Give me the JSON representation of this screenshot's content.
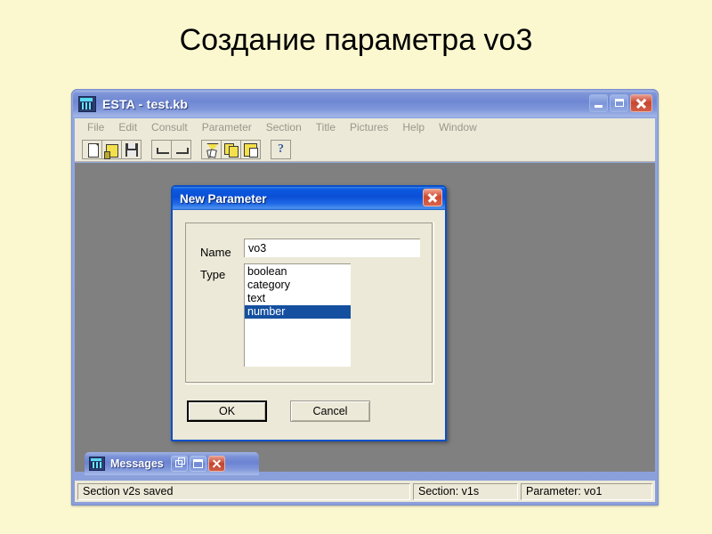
{
  "slide": {
    "title": "Создание параметра vo3",
    "background_color": "#fbf8d0"
  },
  "app_window": {
    "title": "ESTA - test.kb",
    "icon": "esta-app-icon",
    "title_bar_color": "#7f96da",
    "client_color": "#808080",
    "controls": {
      "minimize": "Minimize",
      "maximize": "Maximize",
      "close": "Close"
    },
    "menu": [
      {
        "label": "File"
      },
      {
        "label": "Edit"
      },
      {
        "label": "Consult"
      },
      {
        "label": "Parameter"
      },
      {
        "label": "Section"
      },
      {
        "label": "Title"
      },
      {
        "label": "Pictures"
      },
      {
        "label": "Help"
      },
      {
        "label": "Window"
      }
    ],
    "toolbar": [
      {
        "icon": "new-document-icon",
        "tooltip": "New"
      },
      {
        "icon": "open-folder-icon",
        "tooltip": "Open"
      },
      {
        "icon": "save-floppy-icon",
        "tooltip": "Save"
      },
      {
        "icon": "undo-icon",
        "tooltip": "Undo"
      },
      {
        "icon": "redo-icon",
        "tooltip": "Redo"
      },
      {
        "icon": "cut-scissors-icon",
        "tooltip": "Cut"
      },
      {
        "icon": "copy-icon",
        "tooltip": "Copy"
      },
      {
        "icon": "paste-icon",
        "tooltip": "Paste"
      },
      {
        "icon": "help-question-icon",
        "tooltip": "Help"
      }
    ]
  },
  "dialog": {
    "title": "New Parameter",
    "title_bar_color": "#0a4fd6",
    "close_label": "Close",
    "name": {
      "label": "Name",
      "value": "vo3",
      "placeholder": ""
    },
    "type": {
      "label": "Type",
      "options": [
        {
          "label": "boolean",
          "selected": false
        },
        {
          "label": "category",
          "selected": false
        },
        {
          "label": "text",
          "selected": false
        },
        {
          "label": "number",
          "selected": true
        }
      ],
      "selected_value": "number",
      "selection_color": "#14509f"
    },
    "buttons": {
      "ok": "OK",
      "cancel": "Cancel"
    }
  },
  "messages_window": {
    "title": "Messages",
    "icon": "esta-app-icon",
    "controls": {
      "restore": "Restore",
      "maximize": "Maximize",
      "close": "Close"
    }
  },
  "status_bar": {
    "message": "Section v2s saved",
    "section": "Section: v1s",
    "parameter": "Parameter: vo1"
  }
}
